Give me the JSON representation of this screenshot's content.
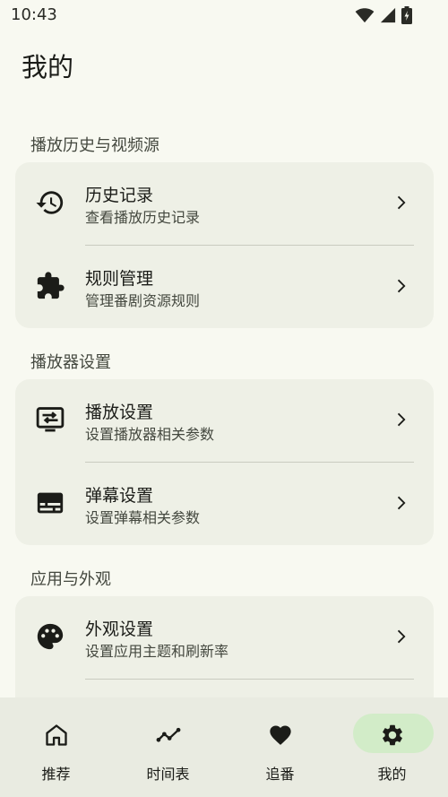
{
  "status_bar": {
    "time": "10:43"
  },
  "page": {
    "title": "我的"
  },
  "sections": [
    {
      "label": "播放历史与视频源",
      "items": [
        {
          "title": "历史记录",
          "subtitle": "查看播放历史记录",
          "icon": "history-icon"
        },
        {
          "title": "规则管理",
          "subtitle": "管理番剧资源规则",
          "icon": "puzzle-icon"
        }
      ]
    },
    {
      "label": "播放器设置",
      "items": [
        {
          "title": "播放设置",
          "subtitle": "设置播放器相关参数",
          "icon": "player-settings-icon"
        },
        {
          "title": "弹幕设置",
          "subtitle": "设置弹幕相关参数",
          "icon": "danmaku-icon"
        }
      ]
    },
    {
      "label": "应用与外观",
      "items": [
        {
          "title": "外观设置",
          "subtitle": "设置应用主题和刷新率",
          "icon": "palette-icon"
        }
      ]
    }
  ],
  "bottom_nav": {
    "items": [
      {
        "label": "推荐",
        "icon": "home-icon"
      },
      {
        "label": "时间表",
        "icon": "timeline-icon"
      },
      {
        "label": "追番",
        "icon": "heart-icon"
      },
      {
        "label": "我的",
        "icon": "gear-icon",
        "active": true
      }
    ]
  },
  "colors": {
    "background": "#f8f9f1",
    "card": "#eef0e6",
    "nav_background": "#e9ebe1",
    "nav_active_pill": "#d2ecc8"
  }
}
